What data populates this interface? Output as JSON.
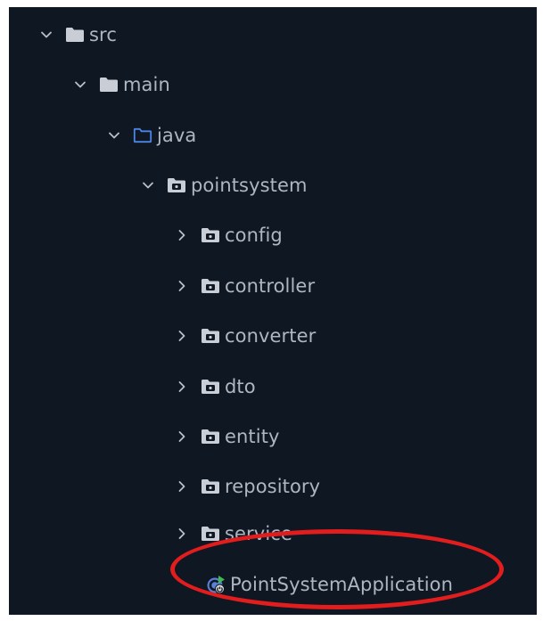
{
  "tree": {
    "src": {
      "label": "src",
      "icon": "folder-icon",
      "expanded": true
    },
    "main": {
      "label": "main",
      "icon": "folder-icon",
      "expanded": true
    },
    "java": {
      "label": "java",
      "icon": "source-root-folder-icon",
      "expanded": true,
      "color": "#4a86e8"
    },
    "pointsystem": {
      "label": "pointsystem",
      "icon": "package-icon",
      "expanded": true
    },
    "packages": [
      {
        "label": "config",
        "icon": "package-icon",
        "expanded": false
      },
      {
        "label": "controller",
        "icon": "package-icon",
        "expanded": false
      },
      {
        "label": "converter",
        "icon": "package-icon",
        "expanded": false
      },
      {
        "label": "dto",
        "icon": "package-icon",
        "expanded": false
      },
      {
        "label": "entity",
        "icon": "package-icon",
        "expanded": false
      },
      {
        "label": "repository",
        "icon": "package-icon",
        "expanded": false
      },
      {
        "label": "service",
        "icon": "package-icon",
        "expanded": false
      }
    ],
    "app_class": {
      "label": "PointSystemApplication",
      "icon": "spring-boot-application-class-icon"
    }
  },
  "colors": {
    "background": "#0f1722",
    "text": "#aeb6c1",
    "folder": "#c9ced6",
    "source_root": "#4a86e8",
    "annotation": "#e21d1d"
  }
}
